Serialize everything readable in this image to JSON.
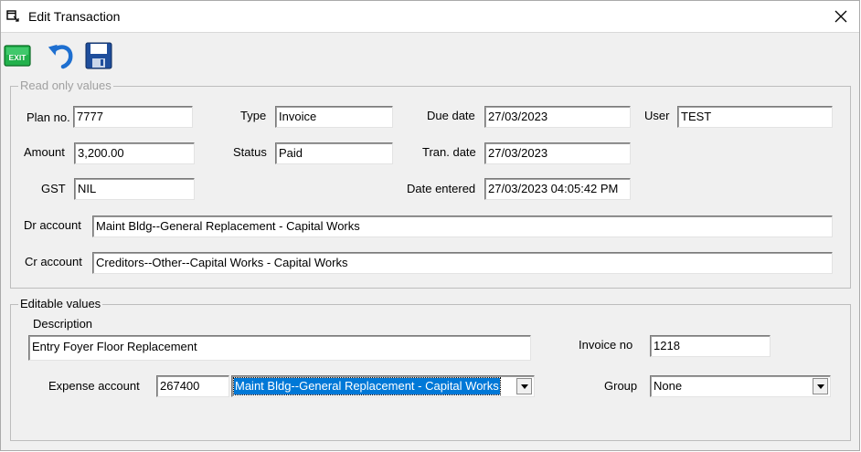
{
  "window": {
    "title": "Edit Transaction"
  },
  "toolbar": {
    "exit_label": "EXIT"
  },
  "readonly": {
    "legend": "Read only values",
    "plan_no": {
      "label": "Plan no.",
      "value": "7777"
    },
    "amount": {
      "label": "Amount",
      "value": "3,200.00"
    },
    "gst": {
      "label": "GST",
      "value": "NIL"
    },
    "type": {
      "label": "Type",
      "value": "Invoice"
    },
    "status": {
      "label": "Status",
      "value": "Paid"
    },
    "due_date": {
      "label": "Due date",
      "value": "27/03/2023"
    },
    "tran_date": {
      "label": "Tran. date",
      "value": "27/03/2023"
    },
    "date_entered": {
      "label": "Date entered",
      "value": "27/03/2023 04:05:42 PM"
    },
    "user": {
      "label": "User",
      "value": "TEST"
    },
    "dr_account": {
      "label": "Dr account",
      "value": "Maint Bldg--General Replacement - Capital Works"
    },
    "cr_account": {
      "label": "Cr account",
      "value": "Creditors--Other--Capital Works - Capital Works"
    }
  },
  "editable": {
    "legend": "Editable values",
    "description": {
      "label": "Description",
      "value": "Entry Foyer Floor Replacement"
    },
    "invoice_no": {
      "label": "Invoice no",
      "value": "1218"
    },
    "expense_account": {
      "label": "Expense account",
      "code": "267400",
      "selected": "Maint Bldg--General Replacement - Capital Works"
    },
    "group": {
      "label": "Group",
      "selected": "None"
    }
  },
  "colors": {
    "selection": "#0078d7",
    "exit_green": "#22b14c",
    "undo_blue": "#1e6fd0",
    "save_blue": "#1f4e9c"
  }
}
